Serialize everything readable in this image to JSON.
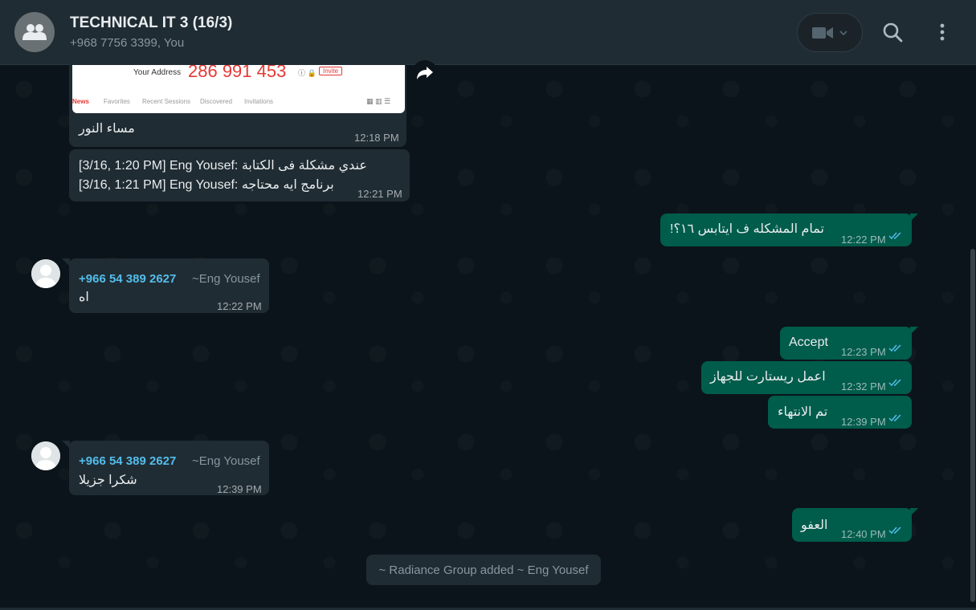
{
  "header": {
    "title": "TECHNICAL IT 3 (16/3)",
    "subtitle": "+968 7756 3399, You"
  },
  "image_preview": {
    "address_label": "Your Address",
    "address_number": "286 991 453",
    "invite_label": "Invite",
    "tabs": [
      "News",
      "Favorites",
      "Recent Sessions",
      "Discovered",
      "Invitations"
    ]
  },
  "messages": [
    {
      "id": "m1",
      "direction": "in",
      "text": "مساء النور",
      "time": "12:18 PM"
    },
    {
      "id": "m2",
      "direction": "in",
      "line1": "[3/16, 1:20 PM] Eng Yousef: عندي مشكلة فى الكتابة",
      "line2": "[3/16, 1:21 PM] Eng Yousef: برنامج ايه محتاجه",
      "time": "12:21 PM"
    },
    {
      "id": "m3",
      "direction": "out",
      "text": "تمام المشكله ف ايتابس ١٦؟!",
      "time": "12:22 PM"
    },
    {
      "id": "m4",
      "direction": "in",
      "sender_phone": "+966 54 389 2627",
      "sender_name": "~Eng Yousef",
      "text": "اه",
      "time": "12:22 PM"
    },
    {
      "id": "m5",
      "direction": "out",
      "text": "Accept",
      "time": "12:23 PM"
    },
    {
      "id": "m6",
      "direction": "out",
      "text": "اعمل ريستارت للجهاز",
      "time": "12:32 PM"
    },
    {
      "id": "m7",
      "direction": "out",
      "text": "تم الانتهاء",
      "time": "12:39 PM"
    },
    {
      "id": "m8",
      "direction": "in",
      "sender_phone": "+966 54 389 2627",
      "sender_name": "~Eng Yousef",
      "text": "شكرا جزيلا",
      "time": "12:39 PM"
    },
    {
      "id": "m9",
      "direction": "out",
      "text": "العفو",
      "time": "12:40 PM"
    }
  ],
  "system_message": "~ Radiance Group added ~ Eng Yousef",
  "colors": {
    "header_bg": "#202c33",
    "chat_bg": "#0b141a",
    "incoming_bubble": "#202c33",
    "outgoing_bubble": "#005c4b",
    "sender_phone": "#53bdeb",
    "read_ticks": "#53bdeb"
  },
  "icons": {
    "group_avatar": "group-avatar-icon",
    "video_call": "video-camera-icon",
    "dropdown": "chevron-down-icon",
    "search": "search-icon",
    "menu": "kebab-menu-icon",
    "forward": "forward-icon",
    "read": "double-check-icon",
    "user_avatar": "default-user-icon"
  }
}
